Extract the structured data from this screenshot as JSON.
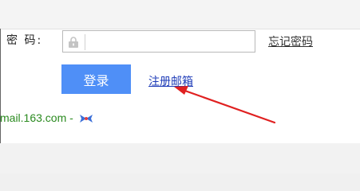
{
  "login_form": {
    "password_label": "密  码:",
    "password_value": "",
    "forgot_password": "忘记密码",
    "login_button": "登录",
    "register_link": "注册邮箱"
  },
  "footer": {
    "domain_text": "mail.163.com",
    "separator": " - "
  },
  "icons": {
    "lock": "lock-icon",
    "bow": "bow-icon"
  },
  "colors": {
    "login_button": "#4f8ff7",
    "register_link": "#1f3cb8",
    "footer_text": "#2a8a1f",
    "annotation_arrow": "#e02020"
  }
}
